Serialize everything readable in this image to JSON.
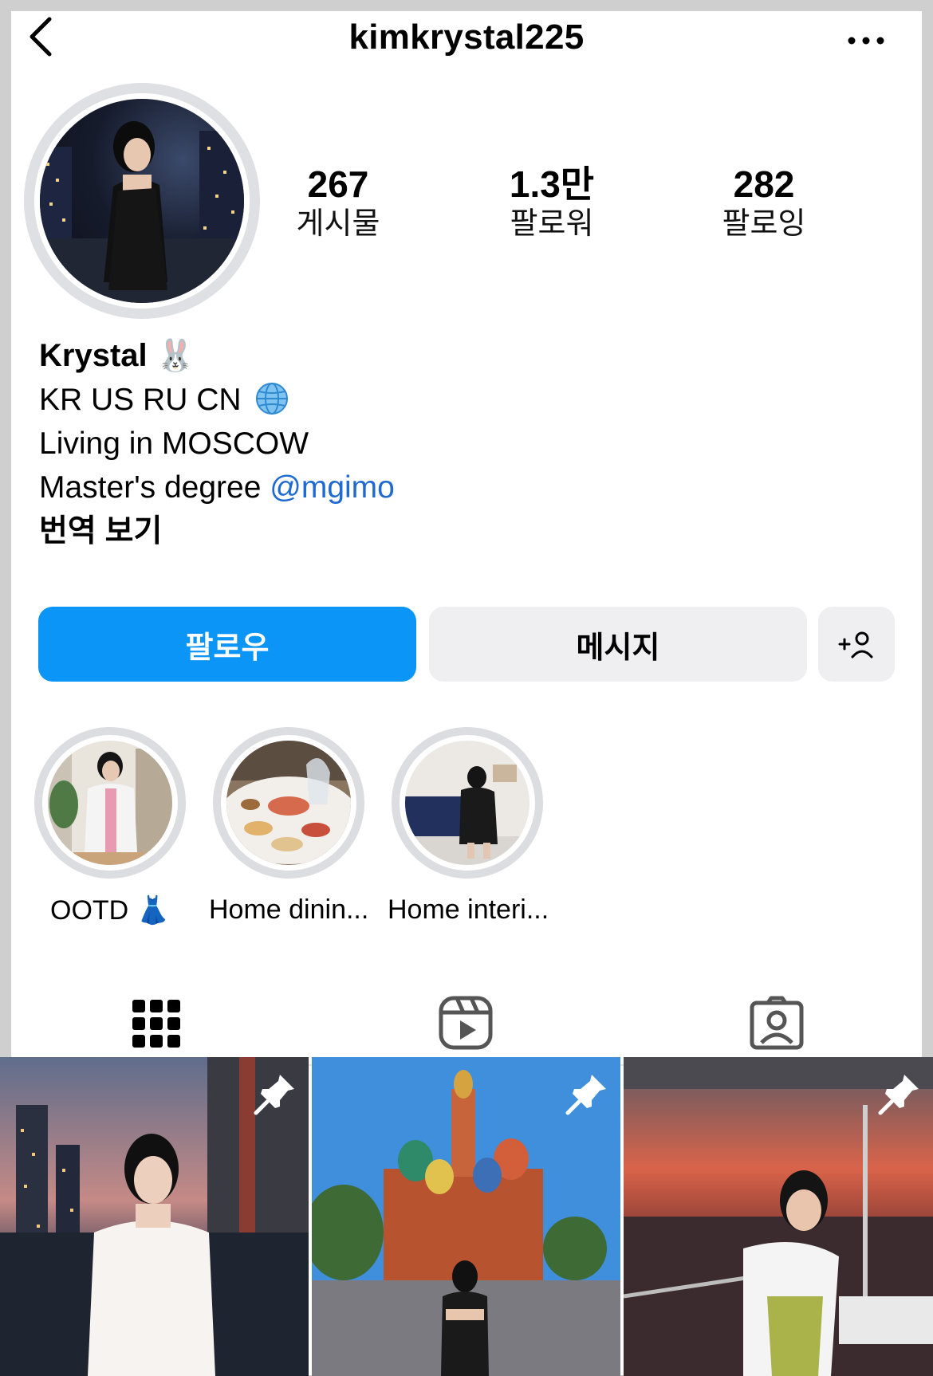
{
  "header": {
    "username": "kimkrystal225"
  },
  "stats": [
    {
      "value": "267",
      "label": "게시물"
    },
    {
      "value": "1.3만",
      "label": "팔로워"
    },
    {
      "value": "282",
      "label": "팔로잉"
    }
  ],
  "bio": {
    "name": "Krystal",
    "name_emoji": "🐰",
    "line1": "KR US RU CN",
    "line1_icon": "globe-icon",
    "line2": "Living in MOSCOW",
    "line3_prefix": "Master's degree ",
    "line3_mention": "@mgimo",
    "translate": "번역 보기"
  },
  "actions": {
    "follow": "팔로우",
    "message": "메시지"
  },
  "highlights": [
    {
      "label": "OOTD 👗"
    },
    {
      "label": "Home dinin..."
    },
    {
      "label": "Home interi..."
    }
  ],
  "tabs": [
    "grid-icon",
    "reels-icon",
    "tagged-icon"
  ],
  "colors": {
    "follow_blue": "#0b95f6",
    "mention_blue": "#1e6ad1",
    "secondary_button": "#efeff1"
  }
}
